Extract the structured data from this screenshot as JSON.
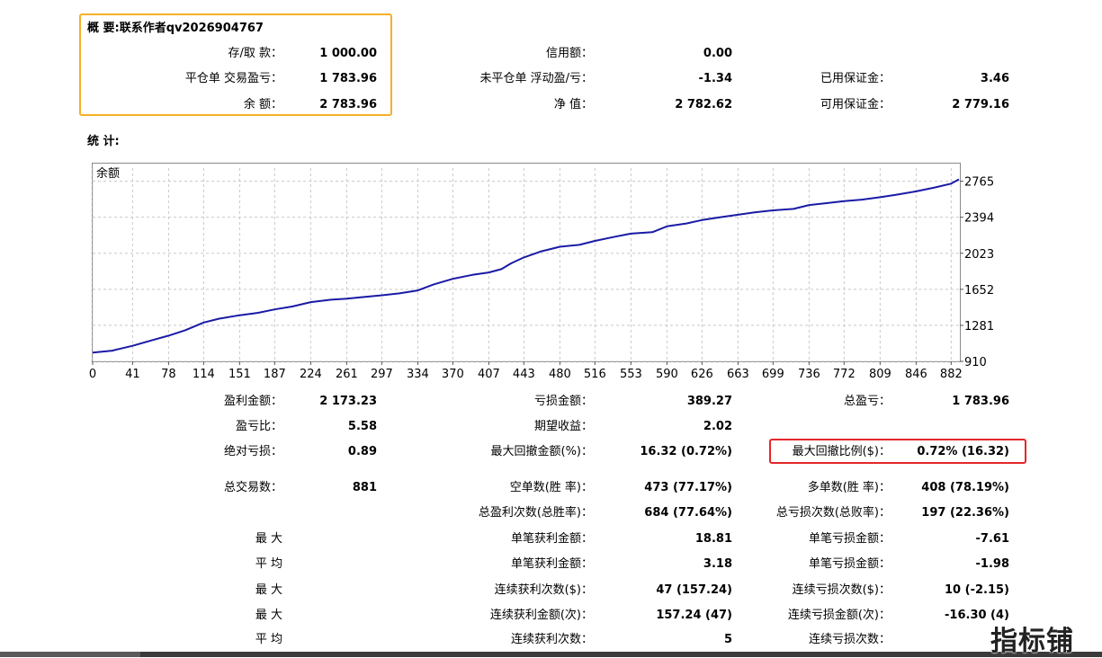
{
  "summary": {
    "title": "概 要:联系作者qv2026904767",
    "rows": [
      [
        {
          "label": "存/取 款：",
          "value": "1 000.00"
        },
        {
          "label": "信用额：",
          "value": "0.00"
        },
        {
          "label": "",
          "value": ""
        }
      ],
      [
        {
          "label": "平仓单 交易盈亏：",
          "value": "1 783.96"
        },
        {
          "label": "未平仓单 浮动盈/亏：",
          "value": "-1.34"
        },
        {
          "label": "已用保证金：",
          "value": "3.46"
        }
      ],
      [
        {
          "label": "余 额：",
          "value": "2 783.96"
        },
        {
          "label": "净 值：",
          "value": "2 782.62"
        },
        {
          "label": "可用保证金：",
          "value": "2 779.16"
        }
      ]
    ]
  },
  "stats": {
    "title": "统 计:",
    "rows": [
      [
        {
          "label": "盈利金额：",
          "value": "2 173.23"
        },
        {
          "label": "亏损金额：",
          "value": "389.27"
        },
        {
          "label": "总盈亏：",
          "value": "1 783.96"
        }
      ],
      [
        {
          "label": "盈亏比：",
          "value": "5.58"
        },
        {
          "label": "期望收益：",
          "value": "2.02"
        },
        {
          "label": "",
          "value": ""
        }
      ],
      [
        {
          "label": "绝对亏损：",
          "value": "0.89"
        },
        {
          "label": "最大回撤金额(%)：",
          "value": "16.32 (0.72%)"
        },
        {
          "label": "最大回撤比例($)：",
          "value": "0.72% (16.32)"
        }
      ],
      [
        {
          "label": "总交易数：",
          "value": "881"
        },
        {
          "label": "空单数(胜 率)：",
          "value": "473 (77.17%)"
        },
        {
          "label": "多单数(胜 率)：",
          "value": "408 (78.19%)"
        }
      ],
      [
        {
          "label": "",
          "value": ""
        },
        {
          "label": "总盈利次数(总胜率)：",
          "value": "684 (77.64%)"
        },
        {
          "label": "总亏损次数(总败率)：",
          "value": "197 (22.36%)"
        }
      ],
      [
        {
          "label": "最 大",
          "value": ""
        },
        {
          "label": "单笔获利金额：",
          "value": "18.81"
        },
        {
          "label": "单笔亏损金额：",
          "value": "-7.61"
        }
      ],
      [
        {
          "label": "平 均",
          "value": ""
        },
        {
          "label": "单笔获利金额：",
          "value": "3.18"
        },
        {
          "label": "单笔亏损金额：",
          "value": "-1.98"
        }
      ],
      [
        {
          "label": "最 大",
          "value": ""
        },
        {
          "label": "连续获利次数($)：",
          "value": "47 (157.24)"
        },
        {
          "label": "连续亏损次数($)：",
          "value": "10 (-2.15)"
        }
      ],
      [
        {
          "label": "最 大",
          "value": ""
        },
        {
          "label": "连续获利金额(次)：",
          "value": "157.24 (47)"
        },
        {
          "label": "连续亏损金额(次)：",
          "value": "-16.30 (4)"
        }
      ],
      [
        {
          "label": "平 均",
          "value": ""
        },
        {
          "label": "连续获利次数：",
          "value": "5"
        },
        {
          "label": "连续亏损次数：",
          "value": ""
        }
      ]
    ]
  },
  "chart_data": {
    "type": "line",
    "title": "余额",
    "xlabel": "",
    "ylabel": "",
    "x_ticks": [
      0,
      41,
      78,
      114,
      151,
      187,
      224,
      261,
      297,
      334,
      370,
      407,
      443,
      480,
      516,
      553,
      590,
      626,
      663,
      699,
      736,
      772,
      809,
      846,
      882
    ],
    "y_ticks": [
      910,
      1281,
      1652,
      2023,
      2394,
      2765
    ],
    "xlim": [
      0,
      890
    ],
    "ylim": [
      910,
      2900
    ],
    "grid": true,
    "line_color": "#1a1aa6",
    "series": [
      {
        "x": [
          0,
          20,
          41,
          60,
          78,
          95,
          114,
          130,
          151,
          170,
          187,
          205,
          224,
          245,
          261,
          280,
          297,
          315,
          334,
          350,
          370,
          390,
          407,
          420,
          430,
          443,
          460,
          480,
          500,
          516,
          535,
          553,
          575,
          590,
          610,
          626,
          645,
          663,
          680,
          699,
          720,
          736,
          755,
          772,
          790,
          809,
          825,
          846,
          865,
          882,
          890
        ],
        "y": [
          1000,
          1020,
          1070,
          1125,
          1175,
          1230,
          1310,
          1350,
          1385,
          1410,
          1445,
          1475,
          1520,
          1545,
          1555,
          1575,
          1590,
          1610,
          1640,
          1700,
          1760,
          1800,
          1825,
          1860,
          1920,
          1980,
          2040,
          2090,
          2110,
          2150,
          2190,
          2225,
          2240,
          2300,
          2330,
          2365,
          2395,
          2420,
          2445,
          2465,
          2480,
          2520,
          2540,
          2560,
          2575,
          2600,
          2625,
          2660,
          2700,
          2740,
          2784
        ]
      }
    ]
  },
  "watermark": "指标铺",
  "colors": {
    "summary_box": "#f5b027",
    "highlight_box": "#e5262b",
    "balance_line": "#1a1aa6",
    "grid": "#c8c8c8"
  }
}
